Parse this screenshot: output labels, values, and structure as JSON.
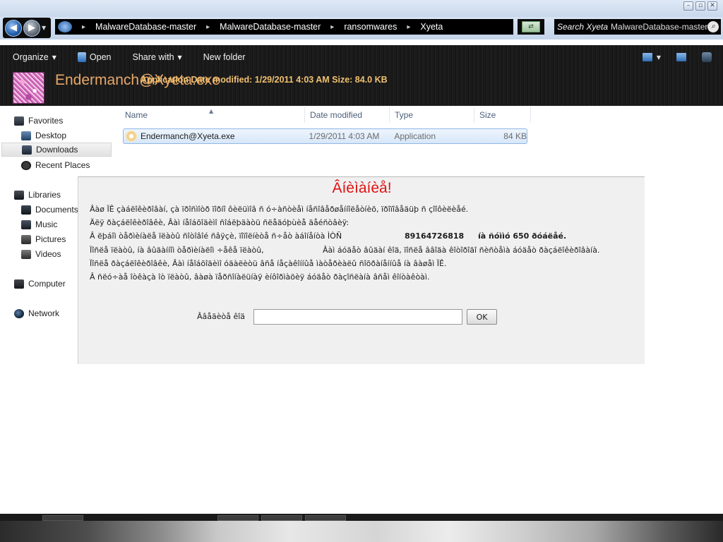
{
  "window": {
    "controls": [
      "–",
      "▫",
      "✕"
    ]
  },
  "address_bar": {
    "crumbs": [
      "MalwareDatabase-master",
      "MalwareDatabase-master",
      "ransomwares",
      "Xyeta"
    ],
    "separator": "▸"
  },
  "search": {
    "placeholder": "Search Xyeta",
    "ghost_text": "MalwareDatabase-master"
  },
  "toolbar": {
    "organize": "Organize",
    "open": "Open",
    "share_with": "Share with",
    "new_folder": "New folder"
  },
  "details_pane": {
    "title": "Endermanch@Xyeta.exe",
    "meta": "Application Date modified: 1/29/2011 4:03 AM Size: 84.0 KB"
  },
  "nav": {
    "favorites": "Favorites",
    "desktop": "Desktop",
    "downloads": "Downloads",
    "recent_places": "Recent Places",
    "libraries": "Libraries",
    "documents": "Documents",
    "music": "Music",
    "pictures": "Pictures",
    "videos": "Videos",
    "computer": "Computer",
    "network": "Network"
  },
  "file_list": {
    "headers": {
      "name": "Name",
      "date_modified": "Date modified",
      "type": "Type",
      "size": "Size"
    },
    "rows": [
      {
        "name": "Endermanch@Xyeta.exe",
        "date_modified": "1/29/2011 4:03 AM",
        "type": "Application",
        "size": "84 KB"
      }
    ]
  },
  "ransom_window": {
    "title": "Âíèìàíèå!",
    "lines": [
      "Âàø ÏÊ çàáëîêèðîâàí, çà ïðîñìîòð ïîðíî ôèëüìîâ ñ ó÷àñòèåì íåñîâåðøåííîëåòíèõ, ïðîïîâåäüþ ñ çîîôèëèåé.",
      "Äëÿ ðàçáëîêèðîâêè, Âàì íåîáõîäèìî ñîáëþäàòü ñëåäóþùèå äåéñòâèÿ:"
    ],
    "line3_text": "Â ëþáîì òåðìèíàëå ïëàòû ñîòîâîé ñâÿçè, ïîïîëíèòå ñ÷åò àáîíåíòà ÌÒÑ",
    "phone": "89164726818",
    "amount": "íà ñóììó 650 ðóáëåé.",
    "line4_text": "Ïîñëå  ïëàòû, íà âûäàííîì òåðìèíàëîì ÷åêå ïëàòû,",
    "line4_tail": "Âàì áóäåò âûäàí êîä, ïîñëå ââîäà êîòîðîãî ñèñòåìà áóäåò ðàçáëîêèðîâàíà.",
    "lines_after": [
      "Ïîñëå ðàçáëîêèðîâêè, Âàì íåîáõîäèìî óäàëèòü âñå íåçàêîííûå ìàòåðèàëû ñîõðàíåííûå íà âàøåì ÏÊ.",
      "Â ñëó÷àå îòêàçà îò ïëàòû, âàøà ïåðñîíàëüíàÿ èíôîðìàöèÿ áóäåò ðàçîñëàíà âñåì êîíòàêòàì."
    ],
    "code_label": "Ââåäèòå êîä",
    "code_value": "",
    "ok_label": "OK"
  },
  "colors": {
    "ransom_title": "#e01010",
    "details_title": "#e8a86a",
    "toolbar_bg": "#1a1a1a"
  }
}
